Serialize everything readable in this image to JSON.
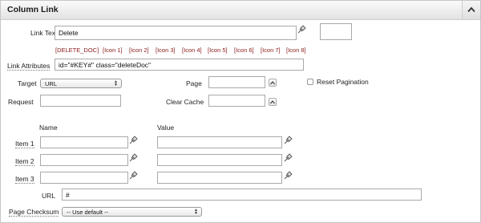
{
  "panel": {
    "title": "Column Link"
  },
  "link_text": {
    "label": "Link Text",
    "value": "Delete"
  },
  "substitutions": [
    "[DELETE_DOC]",
    "[Icon 1]",
    "[Icon 2]",
    "[Icon 3]",
    "[Icon 4]",
    "[Icon 5]",
    "[Icon 6]",
    "[Icon 7]",
    "[Icon 8]"
  ],
  "link_attributes": {
    "label": "Link Attributes",
    "value": "id=\"#KEY#\" class=\"deleteDoc\""
  },
  "target": {
    "label": "Target",
    "value": "URL"
  },
  "page": {
    "label": "Page",
    "value": ""
  },
  "reset_pagination": {
    "label": "Reset Pagination",
    "checked": false
  },
  "request": {
    "label": "Request",
    "value": ""
  },
  "clear_cache": {
    "label": "Clear Cache",
    "value": ""
  },
  "items": {
    "name_header": "Name",
    "value_header": "Value",
    "rows": [
      {
        "label": "Item 1",
        "name": "",
        "value": ""
      },
      {
        "label": "Item 2",
        "name": "",
        "value": ""
      },
      {
        "label": "Item 3",
        "name": "",
        "value": ""
      }
    ]
  },
  "url": {
    "label": "URL",
    "value": "#"
  },
  "page_checksum": {
    "label": "Page Checksum",
    "value": "-- Use default --"
  },
  "icons": {
    "collapse": "chevron-up-icon",
    "picker": "pushpin-icon",
    "page_up": "arrow-up-icon",
    "select_arrows": "updown-arrows-icon"
  }
}
